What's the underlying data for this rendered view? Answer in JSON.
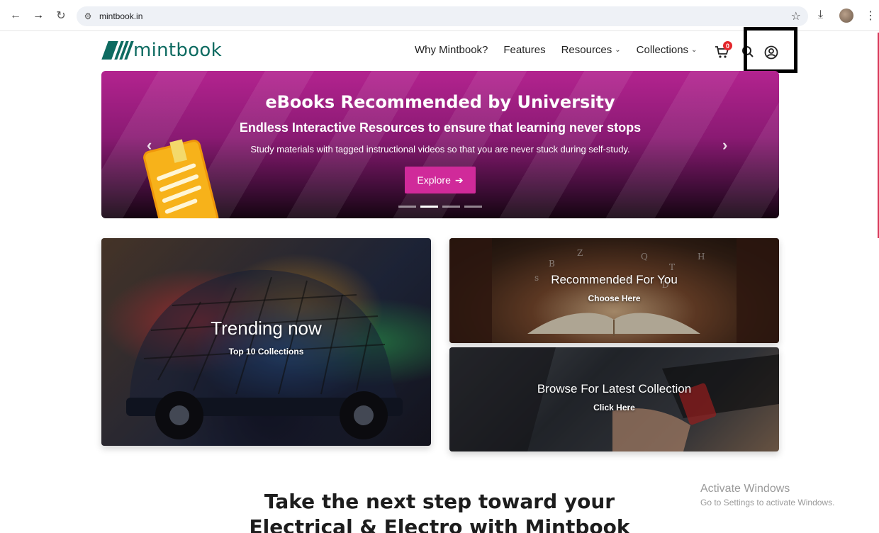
{
  "browser": {
    "url": "mintbook.in"
  },
  "site": {
    "logo_text": "mintbook",
    "menu": [
      {
        "label": "Why Mintbook?",
        "dropdown": false
      },
      {
        "label": "Features",
        "dropdown": false
      },
      {
        "label": "Resources",
        "dropdown": true
      },
      {
        "label": "Collections",
        "dropdown": true
      }
    ],
    "cart_count": "0",
    "brand_color": "#0e6b61"
  },
  "hero": {
    "title": "eBooks Recommended by University",
    "subtitle": "Endless Interactive Resources to ensure that learning never stops",
    "description": "Study materials with tagged instructional videos so that you are never stuck during self-study.",
    "button_label": "Explore",
    "button_icon": "arrow-right-icon",
    "slide_count": 4,
    "active_slide": 2
  },
  "tiles": {
    "trending": {
      "title": "Trending now",
      "subtitle": "Top 10 Collections"
    },
    "recommended": {
      "title": "Recommended For You",
      "subtitle": "Choose Here"
    },
    "browse": {
      "title": "Browse For Latest Collection",
      "subtitle": "Click Here"
    }
  },
  "section": {
    "line1": "Take the next step toward your",
    "line2": "Electrical & Electro with Mintbook"
  },
  "watermark": {
    "title": "Activate Windows",
    "subtitle": "Go to Settings to activate Windows."
  }
}
